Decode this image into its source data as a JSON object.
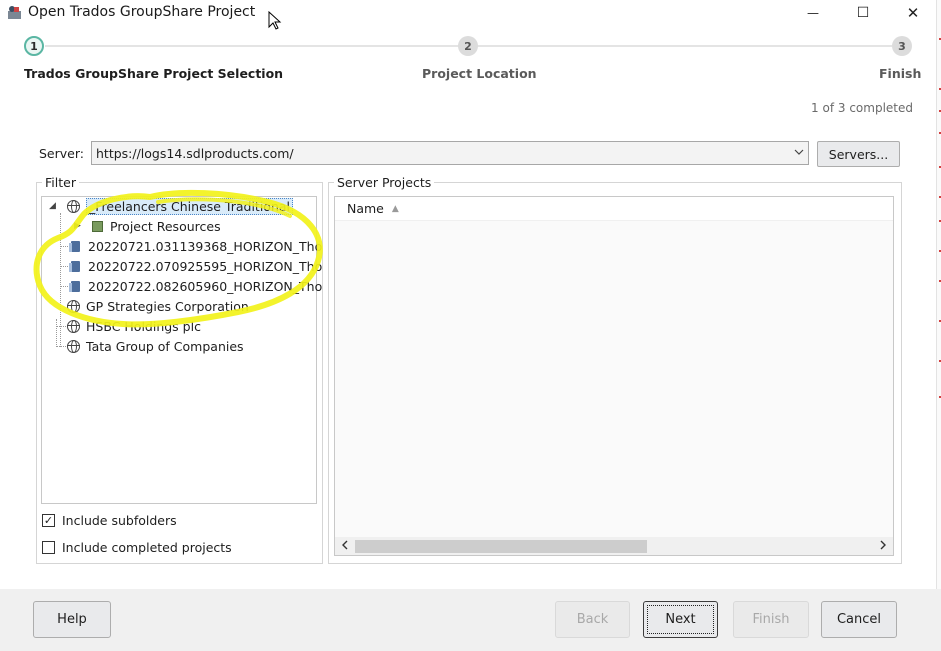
{
  "window": {
    "title": "Open Trados GroupShare Project",
    "minimize_glyph": "—",
    "maximize_glyph": "☐",
    "close_glyph": "✕"
  },
  "stepper": {
    "steps": [
      {
        "number": "1",
        "label": "Trados GroupShare Project Selection",
        "state": "active"
      },
      {
        "number": "2",
        "label": "Project Location",
        "state": "pending"
      },
      {
        "number": "3",
        "label": "Finish",
        "state": "pending"
      }
    ],
    "progress_text": "1 of 3 completed"
  },
  "server": {
    "label": "Server:",
    "value": "https://logs14.sdlproducts.com/",
    "servers_button": "Servers..."
  },
  "filter": {
    "title": "Filter",
    "tree": [
      {
        "label": "_Freelancers Chinese Traditional",
        "icon": "globe-icon",
        "selected": true
      },
      {
        "label": "Project Resources",
        "icon": "resource-icon"
      },
      {
        "label": "20220721.031139368_HORIZON_Tho",
        "icon": "project-icon"
      },
      {
        "label": "20220722.070925595_HORIZON_Tho",
        "icon": "project-icon"
      },
      {
        "label": "20220722.082605960_HORIZON_Tho",
        "icon": "project-icon"
      },
      {
        "label": "GP Strategies Corporation",
        "icon": "globe-icon"
      },
      {
        "label": "HSBC Holdings plc",
        "icon": "globe-icon"
      },
      {
        "label": "Tata Group of Companies",
        "icon": "globe-icon"
      }
    ],
    "include_subfolders": {
      "label": "Include subfolders",
      "checked": true
    },
    "include_completed": {
      "label": "Include completed projects",
      "checked": false
    }
  },
  "server_projects": {
    "title": "Server Projects",
    "column_name": "Name",
    "sort_glyph": "▲"
  },
  "footer": {
    "help": "Help",
    "back": "Back",
    "next": "Next",
    "finish": "Finish",
    "cancel": "Cancel"
  },
  "colors": {
    "accent": "#5ab6a3",
    "highlight_annotation": "#f2f21a",
    "selection": "#d9ebf9"
  }
}
